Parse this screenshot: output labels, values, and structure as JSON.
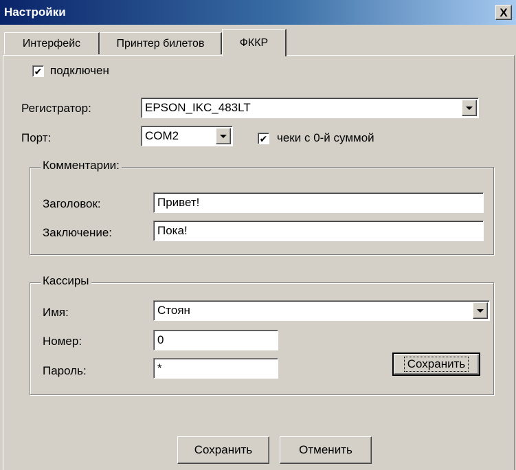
{
  "window": {
    "title": "Настройки",
    "close_glyph": "X"
  },
  "tabs": [
    {
      "label": "Интерфейс",
      "active": false
    },
    {
      "label": "Принтер билетов",
      "active": false
    },
    {
      "label": "ФККР",
      "active": true
    }
  ],
  "fkkr": {
    "connected": {
      "label": "подключен",
      "checked": true,
      "glyph": "✔"
    },
    "registrar": {
      "label": "Регистратор:",
      "value": "EPSON_IKC_483LT"
    },
    "port": {
      "label": "Порт:",
      "value": "COM2"
    },
    "zero_sum": {
      "label": "чеки с 0-й суммой",
      "checked": true,
      "glyph": "✔"
    }
  },
  "comments": {
    "title": "Комментарии:",
    "header_label": "Заголовок:",
    "header_value": "Привет!",
    "footer_label": "Заключение:",
    "footer_value": "Пока!"
  },
  "cashiers": {
    "title": "Кассиры",
    "name_label": "Имя:",
    "name_value": "Стоян",
    "number_label": "Номер:",
    "number_value": "0",
    "password_label": "Пароль:",
    "password_value": "*",
    "save_label": "Сохранить"
  },
  "footer": {
    "save_label": "Сохранить",
    "cancel_label": "Отменить"
  }
}
